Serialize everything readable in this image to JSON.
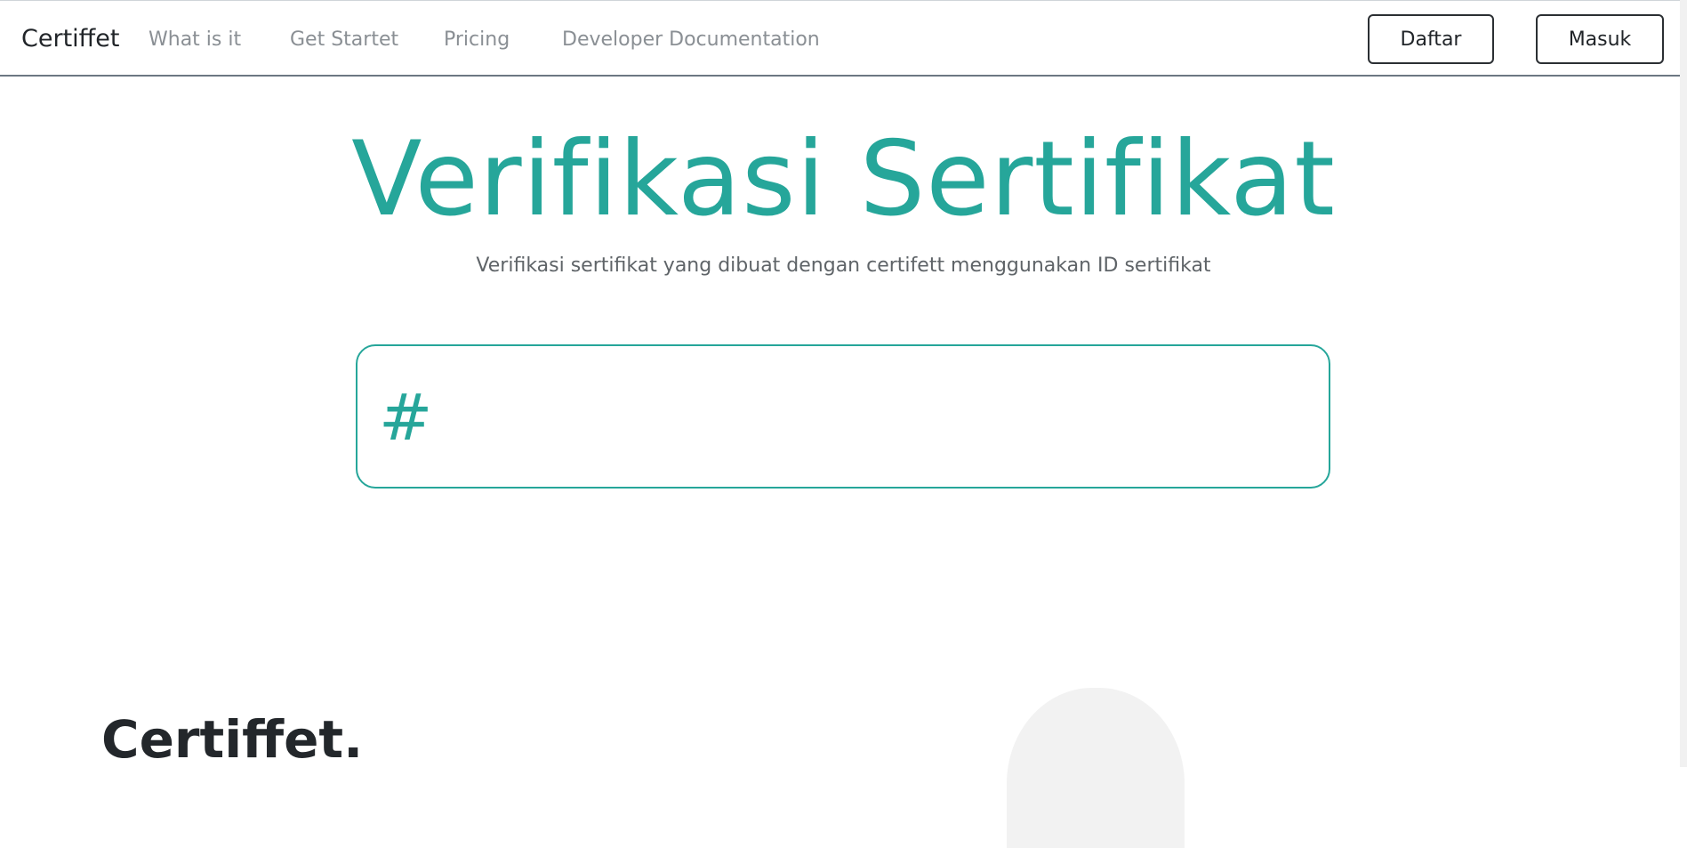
{
  "navbar": {
    "brand": "Certiffet",
    "links": [
      "What is it",
      "Get Startet",
      "Pricing",
      "Developer Documentation"
    ],
    "register_label": "Daftar",
    "login_label": "Masuk"
  },
  "hero": {
    "title": "Verifikasi Sertifikat",
    "subtitle": "Verifikasi sertifikat yang dibuat dengan certifett menggunakan ID sertifikat"
  },
  "verify": {
    "prefix": "#",
    "value": "",
    "placeholder": ""
  },
  "footer": {
    "brand": "Certiffet."
  },
  "colors": {
    "accent": "#26a69a",
    "text": "#212529",
    "muted": "#8a8f94"
  }
}
